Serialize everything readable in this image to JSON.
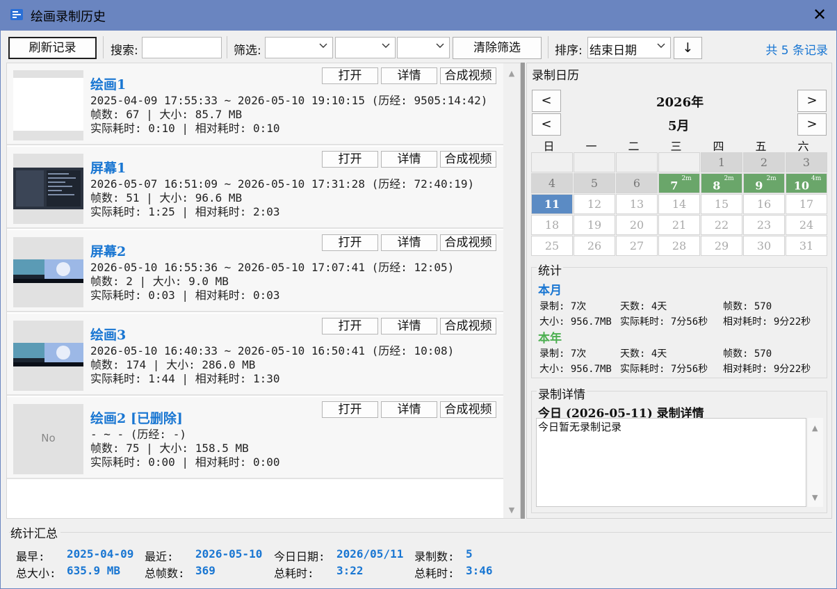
{
  "window": {
    "title": "绘画录制历史"
  },
  "toolbar": {
    "refresh_label": "刷新记录",
    "search_label": "搜索:",
    "search_value": "",
    "filter_label": "筛选:",
    "filter1": "",
    "filter2": "",
    "filter3": "",
    "clear_filter_label": "清除筛选",
    "sort_label": "排序:",
    "sort_value": "结束日期",
    "sort_dir": "↓",
    "count_text": "共 5 条记录"
  },
  "item_buttons": {
    "open": "打开",
    "details": "详情",
    "video": "合成视频"
  },
  "items": [
    {
      "name": "绘画1",
      "time": "2025-04-09 17:55:33 ~ 2026-05-10 19:10:15 (历经: 9505:14:42)",
      "stats": "帧数: 67 | 大小: 85.7 MB",
      "elapsed": "实际耗时: 0:10 | 相对耗时: 0:10"
    },
    {
      "name": "屏幕1",
      "time": "2026-05-07 16:51:09 ~ 2026-05-10 17:31:28 (历经: 72:40:19)",
      "stats": "帧数: 51 | 大小: 96.6 MB",
      "elapsed": "实际耗时: 1:25 | 相对耗时: 2:03"
    },
    {
      "name": "屏幕2",
      "time": "2026-05-10 16:55:36 ~ 2026-05-10 17:07:41 (历经: 12:05)",
      "stats": "帧数: 2 | 大小: 9.0 MB",
      "elapsed": "实际耗时: 0:03 | 相对耗时: 0:03"
    },
    {
      "name": "绘画3",
      "time": "2026-05-10 16:40:33 ~ 2026-05-10 16:50:41 (历经: 10:08)",
      "stats": "帧数: 174 | 大小: 286.0 MB",
      "elapsed": "实际耗时: 1:44 | 相对耗时: 1:30"
    },
    {
      "name": "绘画2 [已删除]",
      "time": "- ~ - (历经: -)",
      "stats": "帧数: 75 | 大小: 158.5 MB",
      "elapsed": "实际耗时: 0:00 | 相对耗时: 0:00",
      "thumb_text": "No"
    }
  ],
  "calendar": {
    "section_title": "录制日历",
    "year": "2026年",
    "month": "5月",
    "prev": "<",
    "next": ">",
    "weekdays": [
      "日",
      "一",
      "二",
      "三",
      "四",
      "五",
      "六"
    ],
    "row0": [
      "",
      "",
      "",
      "",
      "1",
      "2",
      "3"
    ],
    "row1": [
      "4",
      "5",
      "6",
      "7",
      "8",
      "9",
      "10"
    ],
    "row1_badges": [
      "",
      "",
      "",
      "2m",
      "2m",
      "2m",
      "4m"
    ],
    "row2": [
      "11",
      "12",
      "13",
      "14",
      "15",
      "16",
      "17"
    ],
    "row3": [
      "18",
      "19",
      "20",
      "21",
      "22",
      "23",
      "24"
    ],
    "row4": [
      "25",
      "26",
      "27",
      "28",
      "29",
      "30",
      "31"
    ],
    "colors": {
      "recorded": "#6aa66a",
      "today": "#5b8bc4"
    }
  },
  "stats": {
    "section_title": "统计",
    "month_title": "本月",
    "year_title": "本年",
    "month": {
      "rec": "录制: 7次",
      "days": "天数: 4天",
      "frames": "帧数: 570",
      "size": "大小: 956.7MB",
      "actual": "实际耗时: 7分56秒",
      "relative": "相对耗时: 9分22秒"
    },
    "year": {
      "rec": "录制: 7次",
      "days": "天数: 4天",
      "frames": "帧数: 570",
      "size": "大小: 956.7MB",
      "actual": "实际耗时: 7分56秒",
      "relative": "相对耗时: 9分22秒"
    },
    "month_color": "#1976d2",
    "year_color": "#4caf50"
  },
  "details": {
    "section_title": "录制详情",
    "heading": "今日 (2026-05-11) 录制详情",
    "body": "今日暂无录制记录"
  },
  "summary": {
    "title": "统计汇总",
    "earliest_label": "最早:",
    "earliest": "2025-04-09",
    "latest_label": "最近:",
    "latest": "2026-05-10",
    "today_label": "今日日期:",
    "today": "2026/05/11",
    "count_label": "录制数:",
    "count": "5",
    "size_label": "总大小:",
    "size": "635.9 MB",
    "frames_label": "总帧数:",
    "frames": "369",
    "ratio_label": "总耗时:",
    "ratio": "3:22",
    "total_label": "总耗时:",
    "total": "3:46"
  }
}
